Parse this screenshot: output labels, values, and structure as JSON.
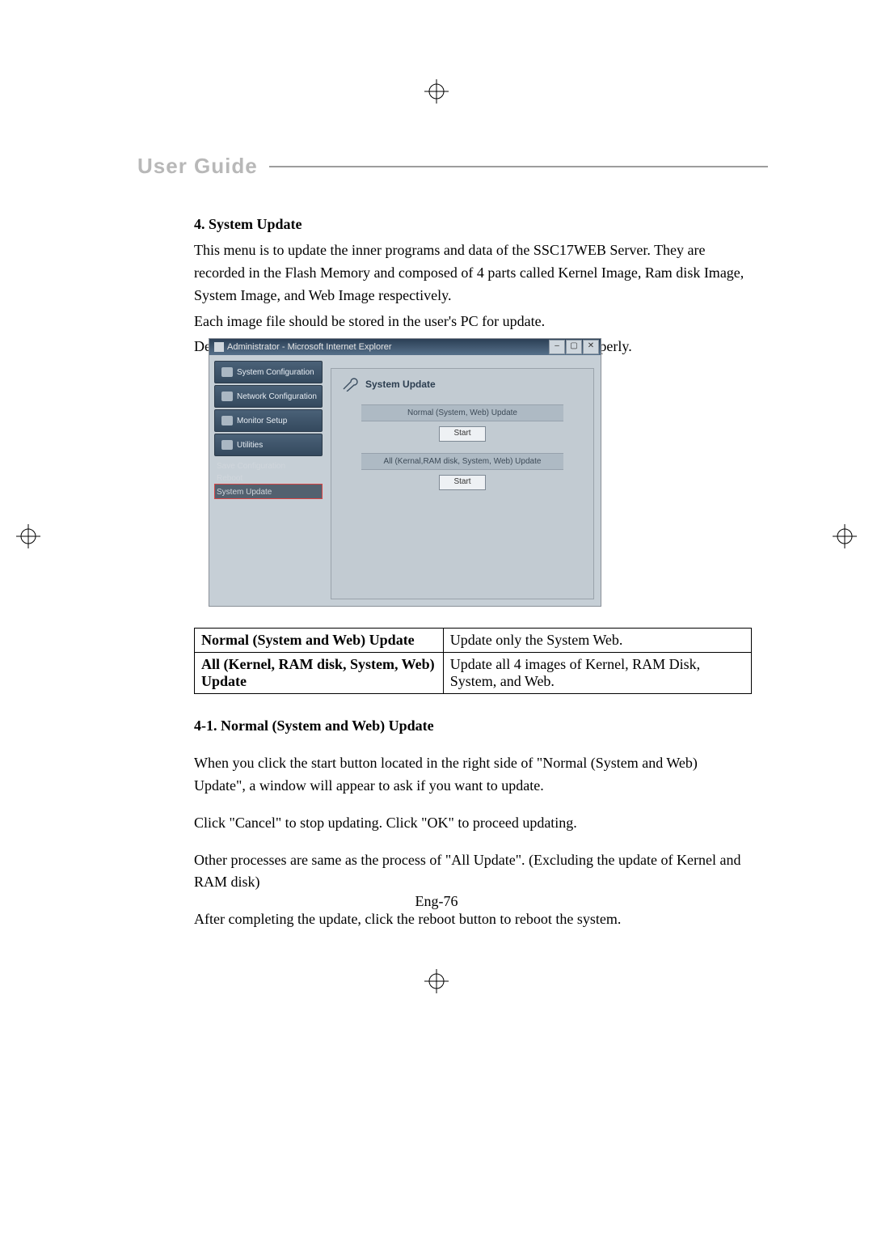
{
  "header_title": "User Guide",
  "section_title": "4. System Update",
  "para1": "This menu is to update the inner programs and data of the SSC17WEB Server. They are recorded in the Flash Memory and composed of 4 parts called Kernel Image, Ram disk Image, System Image, and Web Image respectively.",
  "para2": "Each image file should be stored in the user's PC for update.",
  "para3": "Depending on the range you want to update, press the start button properly.",
  "shot": {
    "window_title": "Administrator - Microsoft Internet Explorer",
    "nav": [
      "System Configuration",
      "Network Configuration",
      "Monitor Setup",
      "Utilities"
    ],
    "sub1": "Save Configuration",
    "sub2": "Reboot",
    "sub3": "System Update",
    "panel_title": "System Update",
    "label1": "Normal (System, Web) Update",
    "btn1": "Start",
    "label2": "All (Kernal,RAM disk, System, Web) Update",
    "btn2": "Start",
    "win_min": "–",
    "win_max": "▢",
    "win_close": "✕"
  },
  "table": {
    "r1c1": "Normal (System and Web) Update",
    "r1c2": "Update only the System Web.",
    "r2c1": "All (Kernel, RAM disk, System, Web) Update",
    "r2c2": "Update all 4 images of Kernel, RAM Disk, System, and Web."
  },
  "subsection_title": "4-1. Normal (System and Web) Update",
  "p4": "When you click the start button located in the right side of \"Normal (System and Web) Update\", a window will appear to ask if you want to update.",
  "p5": "Click \"Cancel\" to stop updating. Click \"OK\" to proceed updating.",
  "p6": "Other processes are same as the process of \"All Update\". (Excluding the update of Kernel and RAM disk)",
  "p7": "After completing the update, click the reboot button to reboot the system.",
  "page_number": "Eng-76"
}
